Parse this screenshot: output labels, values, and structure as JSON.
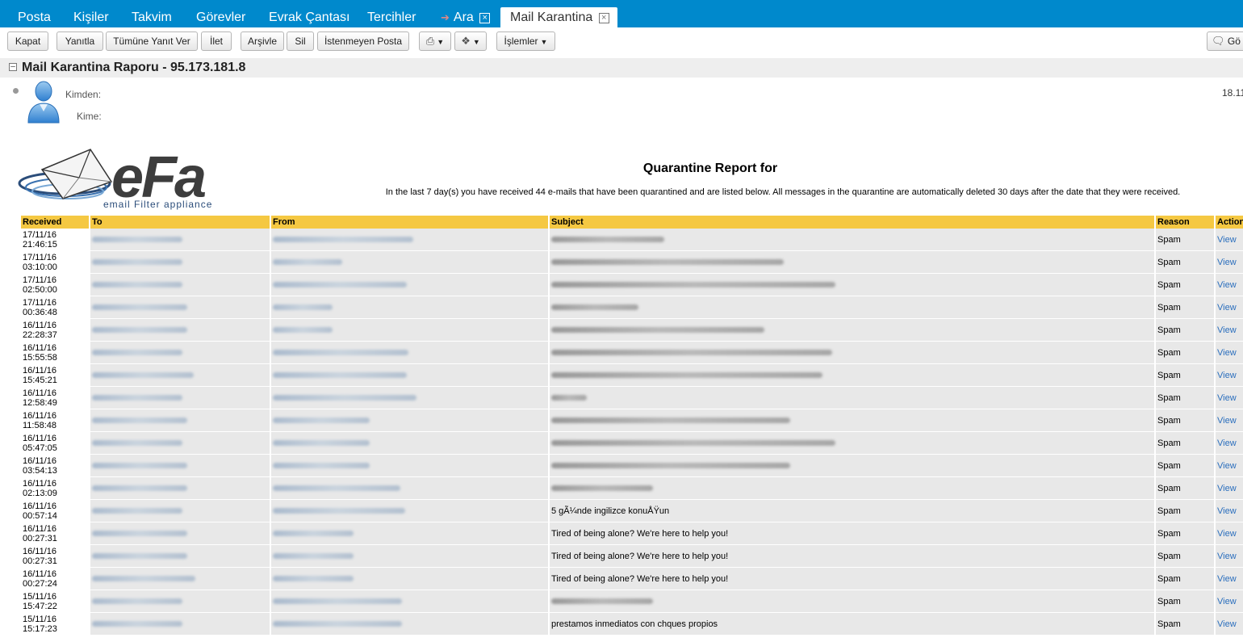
{
  "tabs": [
    {
      "label": "Posta"
    },
    {
      "label": "Kişiler"
    },
    {
      "label": "Takvim"
    },
    {
      "label": "Görevler"
    },
    {
      "label": "Evrak Çantası"
    },
    {
      "label": "Tercihler"
    },
    {
      "label": "Ara"
    },
    {
      "label": "Mail Karantina"
    }
  ],
  "toolbar": {
    "close": "Kapat",
    "reply": "Yanıtla",
    "reply_all": "Tümüne Yanıt Ver",
    "forward": "İlet",
    "archive": "Arşivle",
    "delete": "Sil",
    "spam": "İstenmeyen Posta",
    "actions": "İşlemler",
    "right_label": "Gö"
  },
  "message": {
    "subject": "Mail Karantina Raporu - 95.173.181.8",
    "from_label": "Kimden:",
    "to_label": "Kime:",
    "date": "18.11"
  },
  "logo": {
    "name": "eFa",
    "tagline": "email Filter appliance"
  },
  "report": {
    "title": "Quarantine Report for",
    "intro": "In the last 7 day(s) you have received 44 e-mails that have been quarantined and are listed below. All messages in the quarantine are automatically deleted 30 days after the date that they were received.",
    "columns": {
      "received": "Received",
      "to": "To",
      "from": "From",
      "subject": "Subject",
      "reason": "Reason",
      "action": "Action"
    },
    "rows": [
      {
        "date": "17/11/16",
        "time": "21:46:15",
        "subject": "",
        "reason": "Spam",
        "action": "View"
      },
      {
        "date": "17/11/16",
        "time": "03:10:00",
        "subject": "",
        "reason": "Spam",
        "action": "View"
      },
      {
        "date": "17/11/16",
        "time": "02:50:00",
        "subject": "",
        "reason": "Spam",
        "action": "View"
      },
      {
        "date": "17/11/16",
        "time": "00:36:48",
        "subject": "",
        "reason": "Spam",
        "action": "View"
      },
      {
        "date": "16/11/16",
        "time": "22:28:37",
        "subject": "",
        "reason": "Spam",
        "action": "View"
      },
      {
        "date": "16/11/16",
        "time": "15:55:58",
        "subject": "",
        "reason": "Spam",
        "action": "View"
      },
      {
        "date": "16/11/16",
        "time": "15:45:21",
        "subject": "",
        "reason": "Spam",
        "action": "View"
      },
      {
        "date": "16/11/16",
        "time": "12:58:49",
        "subject": "",
        "reason": "Spam",
        "action": "View"
      },
      {
        "date": "16/11/16",
        "time": "11:58:48",
        "subject": "",
        "reason": "Spam",
        "action": "View"
      },
      {
        "date": "16/11/16",
        "time": "05:47:05",
        "subject": "",
        "reason": "Spam",
        "action": "View"
      },
      {
        "date": "16/11/16",
        "time": "03:54:13",
        "subject": "",
        "reason": "Spam",
        "action": "View"
      },
      {
        "date": "16/11/16",
        "time": "02:13:09",
        "subject": "",
        "reason": "Spam",
        "action": "View"
      },
      {
        "date": "16/11/16",
        "time": "00:57:14",
        "subject": "5 gÃ¼nde ingilizce konuÅŸun",
        "reason": "Spam",
        "action": "View"
      },
      {
        "date": "16/11/16",
        "time": "00:27:31",
        "subject": "Tired of being alone? We're here to help you!",
        "reason": "Spam",
        "action": "View"
      },
      {
        "date": "16/11/16",
        "time": "00:27:31",
        "subject": "Tired of being alone? We're here to help you!",
        "reason": "Spam",
        "action": "View"
      },
      {
        "date": "16/11/16",
        "time": "00:27:24",
        "subject": "Tired of being alone? We're here to help you!",
        "reason": "Spam",
        "action": "View"
      },
      {
        "date": "15/11/16",
        "time": "15:47:22",
        "subject": "",
        "reason": "Spam",
        "action": "View"
      },
      {
        "date": "15/11/16",
        "time": "15:17:23",
        "subject": "prestamos inmediatos con chques propios",
        "reason": "Spam",
        "action": "View"
      }
    ]
  }
}
